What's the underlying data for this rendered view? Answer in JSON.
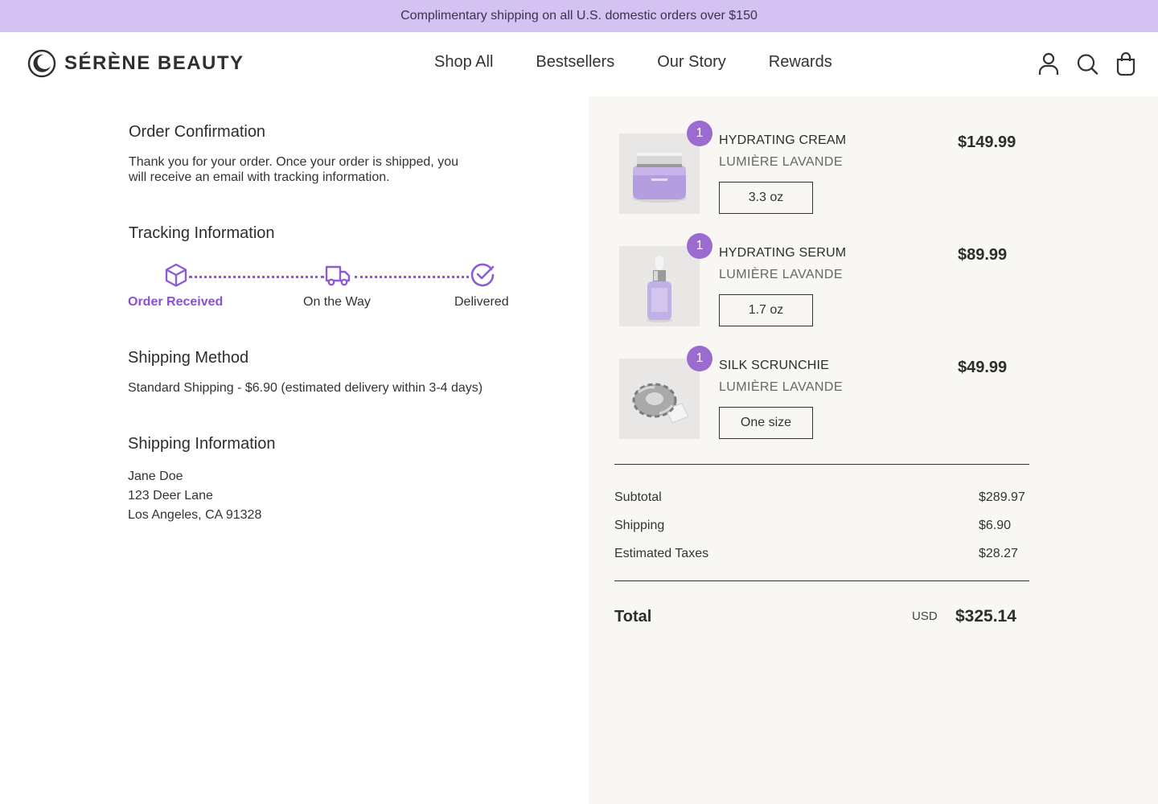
{
  "announcement": "Complimentary shipping on all U.S. domestic orders over $150",
  "brand": {
    "name": "SÉRÈNE BEAUTY",
    "accent": "#8a4fd8",
    "banner": "#d4c2f2"
  },
  "nav": [
    "Shop All",
    "Bestsellers",
    "Our Story",
    "Rewards"
  ],
  "header_icons": [
    "account-icon",
    "search-icon",
    "bag-icon"
  ],
  "confirmation": {
    "title": "Order Confirmation",
    "message_line1": "Thank you for your order. Once your order is shipped, you",
    "message_line2": "will receive an email with tracking information."
  },
  "tracking": {
    "title": "Tracking Information",
    "steps": [
      {
        "label": "Order Received",
        "icon": "box-icon",
        "active": true
      },
      {
        "label": "On the Way",
        "icon": "truck-icon",
        "active": false
      },
      {
        "label": "Delivered",
        "icon": "check-circle-icon",
        "active": false
      }
    ]
  },
  "shipping_method": {
    "title": "Shipping Method",
    "text": "Standard Shipping - $6.90 (estimated delivery within 3-4 days)"
  },
  "shipping_info": {
    "title": "Shipping Information",
    "name": "Jane Doe",
    "street": "123 Deer Lane",
    "city": "Los Angeles, CA 91328"
  },
  "items": [
    {
      "qty": "1",
      "name": "HYDRATING CREAM",
      "brand": "LUMIÈRE LAVANDE",
      "size": "3.3 oz",
      "price": "$149.99"
    },
    {
      "qty": "1",
      "name": "HYDRATING SERUM",
      "brand": "LUMIÈRE LAVANDE",
      "size": "1.7 oz",
      "price": "$89.99"
    },
    {
      "qty": "1",
      "name": "SILK SCRUNCHIE",
      "brand": "LUMIÈRE LAVANDE",
      "size": "One size",
      "price": "$49.99"
    }
  ],
  "summary": {
    "subtotal_label": "Subtotal",
    "subtotal": "$289.97",
    "shipping_label": "Shipping",
    "shipping": "$6.90",
    "taxes_label": "Estimated Taxes",
    "taxes": "$28.27",
    "total_label": "Total",
    "currency": "USD",
    "total": "$325.14"
  }
}
